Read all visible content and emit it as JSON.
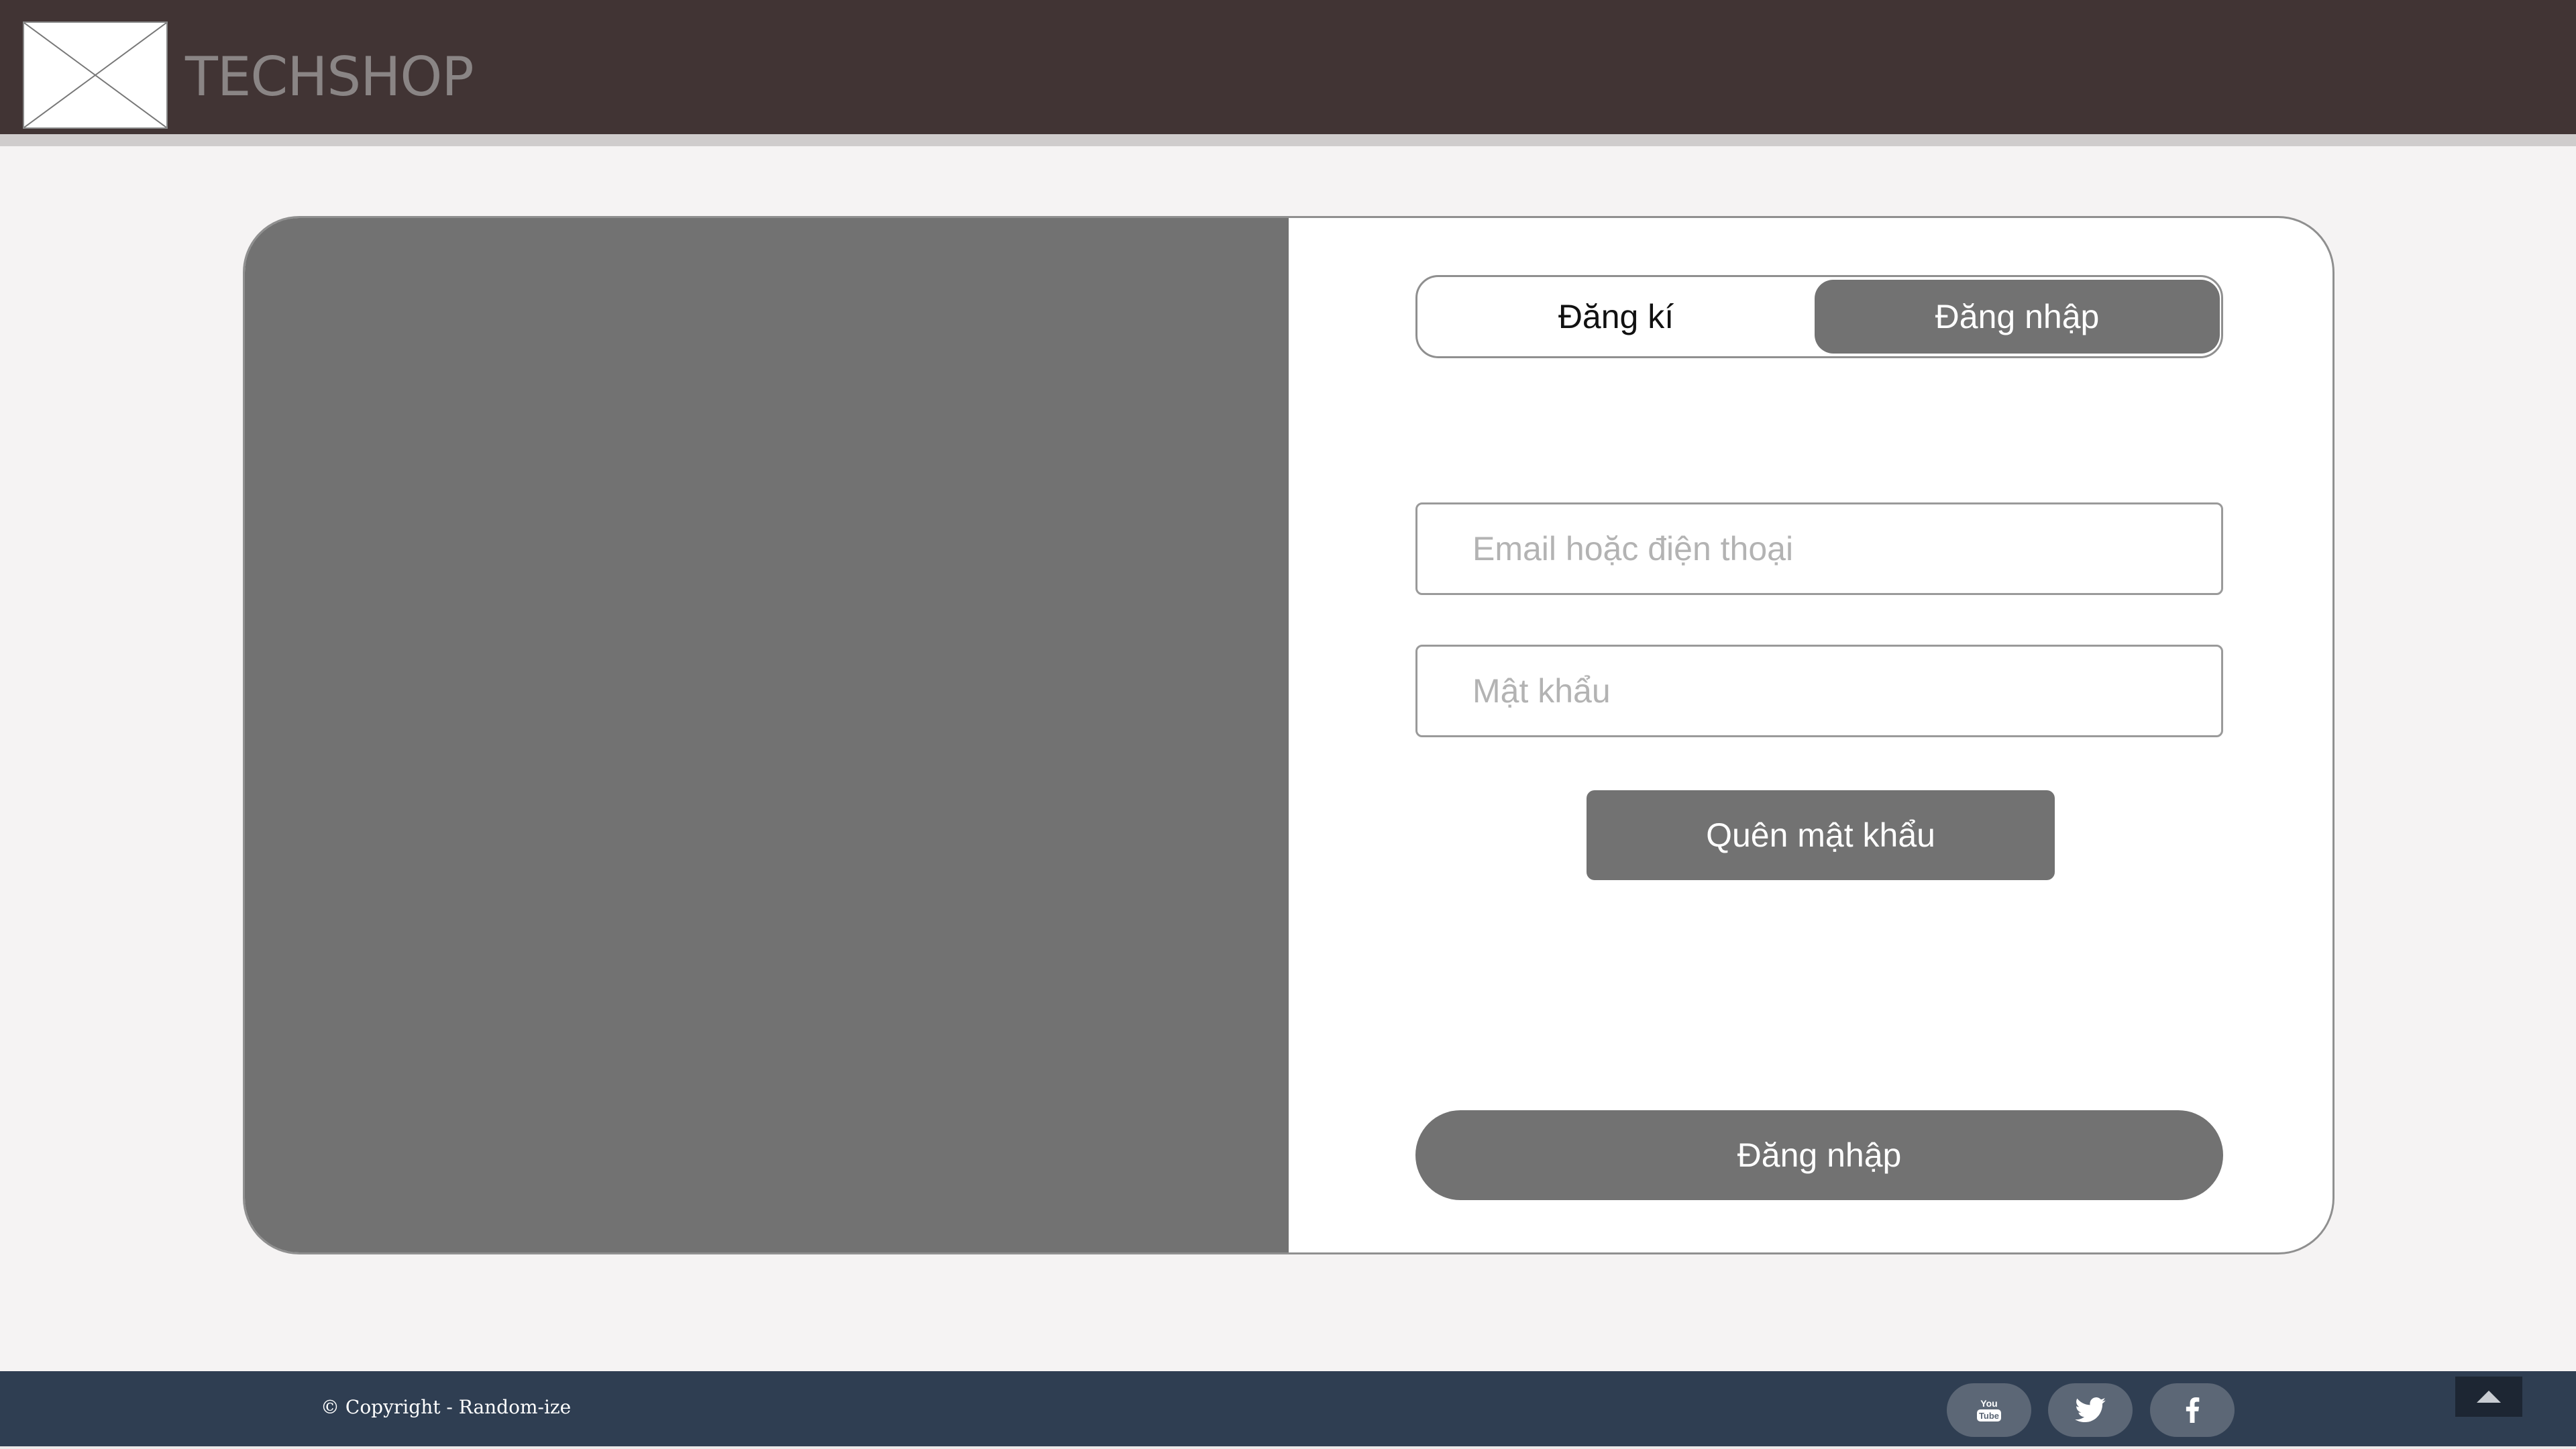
{
  "header": {
    "brand": "TECHSHOP",
    "logo_icon": "image-placeholder-icon"
  },
  "auth_tabs": {
    "register_label": "Đăng kí",
    "login_label": "Đăng nhập",
    "active": "login"
  },
  "form": {
    "email_placeholder": "Email hoặc điện thoại",
    "password_placeholder": "Mật khẩu",
    "forgot_label": "Quên mật khẩu",
    "submit_label": "Đăng nhập"
  },
  "footer": {
    "copyright": "© Copyright - Random-ize",
    "social_icons": [
      "youtube-icon",
      "twitter-icon",
      "facebook-icon"
    ],
    "back_to_top_icon": "caret-up-icon"
  },
  "colors": {
    "header_bg": "#413434",
    "footer_bg": "#2f3e52",
    "accent_gray": "#727272",
    "page_bg": "#f5f3f3"
  }
}
